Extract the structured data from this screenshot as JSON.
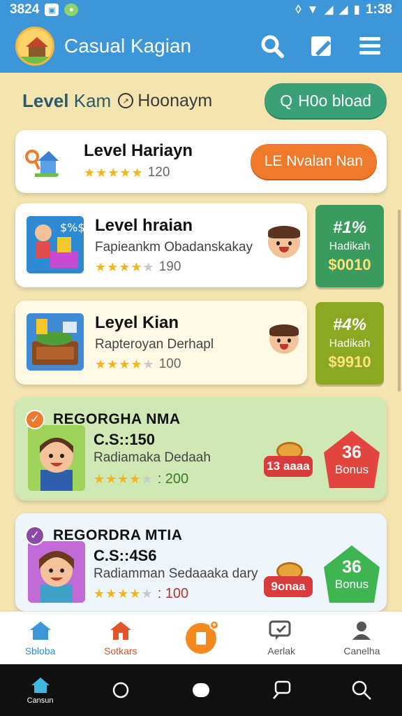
{
  "status_bar": {
    "left_text": "3824",
    "time": "1:38",
    "left_icons": [
      "image-icon",
      "chat-icon"
    ],
    "right_icons": [
      "vibrate-icon",
      "wifi-icon",
      "signal-icon",
      "signal-icon",
      "battery-icon"
    ]
  },
  "header": {
    "title": "Casual Kagian",
    "icons": [
      "search-icon",
      "edit-icon",
      "menu-icon"
    ]
  },
  "section": {
    "title_bold": "Level",
    "title_light": "Kam",
    "subtitle": "Hoonaym",
    "action_icon": "Q",
    "action_label": "H0o bload"
  },
  "cards": [
    {
      "title": "Level Hariayn",
      "rating": "120",
      "stars": 5,
      "button": "LE Nvalan Nan"
    },
    {
      "title": "Level hraian",
      "desc": "Fapieankm Obadanskakay",
      "rating": "190",
      "stars": 4,
      "tile_top": "#1%",
      "tile_mid": "Hadikah",
      "tile_val": "$0010",
      "tile_color": "#3b9a5e"
    },
    {
      "title": "Leyel Kian",
      "desc": "Rapteroyan Derhapl",
      "rating": "100",
      "stars": 4,
      "tile_top": "#4%",
      "tile_mid": "Hadikah",
      "tile_val": "$9910",
      "tile_color": "#8aa822"
    },
    {
      "badge": "REGORGHA NMA",
      "code": "C.S::150",
      "desc": "Radiamaka Dedaah",
      "rating": ": 200",
      "stars": 4,
      "coin_label": "13 aaaa",
      "bonus_num": "36",
      "bonus_label": "Bonus",
      "bonus_color": "#e2453f",
      "check_color": "#f07a2c"
    },
    {
      "badge": "REGORDRA MTIA",
      "code": "C.S::4S6",
      "desc": "Radiamman Sedaaaka dary",
      "rating": ": 100",
      "stars": 4,
      "coin_label": "9onaa",
      "bonus_num": "36",
      "bonus_label": "Bonus",
      "bonus_color": "#3fb552",
      "check_color": "#8b4aa8"
    }
  ],
  "bottom_nav": [
    {
      "label": "Sbloba",
      "icon": "home-icon"
    },
    {
      "label": "Sotkars",
      "icon": "house-icon"
    },
    {
      "label": "",
      "icon": "center-action-icon"
    },
    {
      "label": "Aerlak",
      "icon": "chat-icon"
    },
    {
      "label": "Canelha",
      "icon": "profile-icon"
    }
  ],
  "system_nav": {
    "home_label": "Cansun"
  },
  "colors": {
    "header": "#3d96d8",
    "background": "#f3e4b0",
    "accent_green": "#3aa077",
    "accent_orange": "#f07a2c"
  }
}
